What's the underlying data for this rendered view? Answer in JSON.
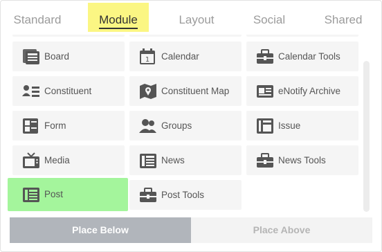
{
  "tabs": [
    {
      "label": "Standard"
    },
    {
      "label": "Module"
    },
    {
      "label": "Layout"
    },
    {
      "label": "Social"
    },
    {
      "label": "Shared"
    }
  ],
  "active_tab": "Module",
  "modules": [
    {
      "label": "Board",
      "icon": "board-icon"
    },
    {
      "label": "Calendar",
      "icon": "calendar-icon"
    },
    {
      "label": "Calendar Tools",
      "icon": "toolbox-icon"
    },
    {
      "label": "Constituent",
      "icon": "constituent-icon"
    },
    {
      "label": "Constituent Map",
      "icon": "map-marker-icon"
    },
    {
      "label": "eNotify Archive",
      "icon": "id-card-icon"
    },
    {
      "label": "Form",
      "icon": "form-icon"
    },
    {
      "label": "Groups",
      "icon": "groups-icon"
    },
    {
      "label": "Issue",
      "icon": "issue-icon"
    },
    {
      "label": "Media",
      "icon": "tv-icon"
    },
    {
      "label": "News",
      "icon": "newspaper-icon"
    },
    {
      "label": "News Tools",
      "icon": "toolbox-icon"
    },
    {
      "label": "Post",
      "icon": "newspaper-icon",
      "selected": true
    },
    {
      "label": "Post Tools",
      "icon": "toolbox-icon"
    }
  ],
  "footer": {
    "place_below": "Place Below",
    "place_above": "Place Above"
  },
  "colors": {
    "active_tab_bg": "#fbf683",
    "selected_tile_bg": "#a4f59c",
    "tile_bg": "#f5f5f5",
    "primary_button_bg": "#b1b5bb"
  }
}
